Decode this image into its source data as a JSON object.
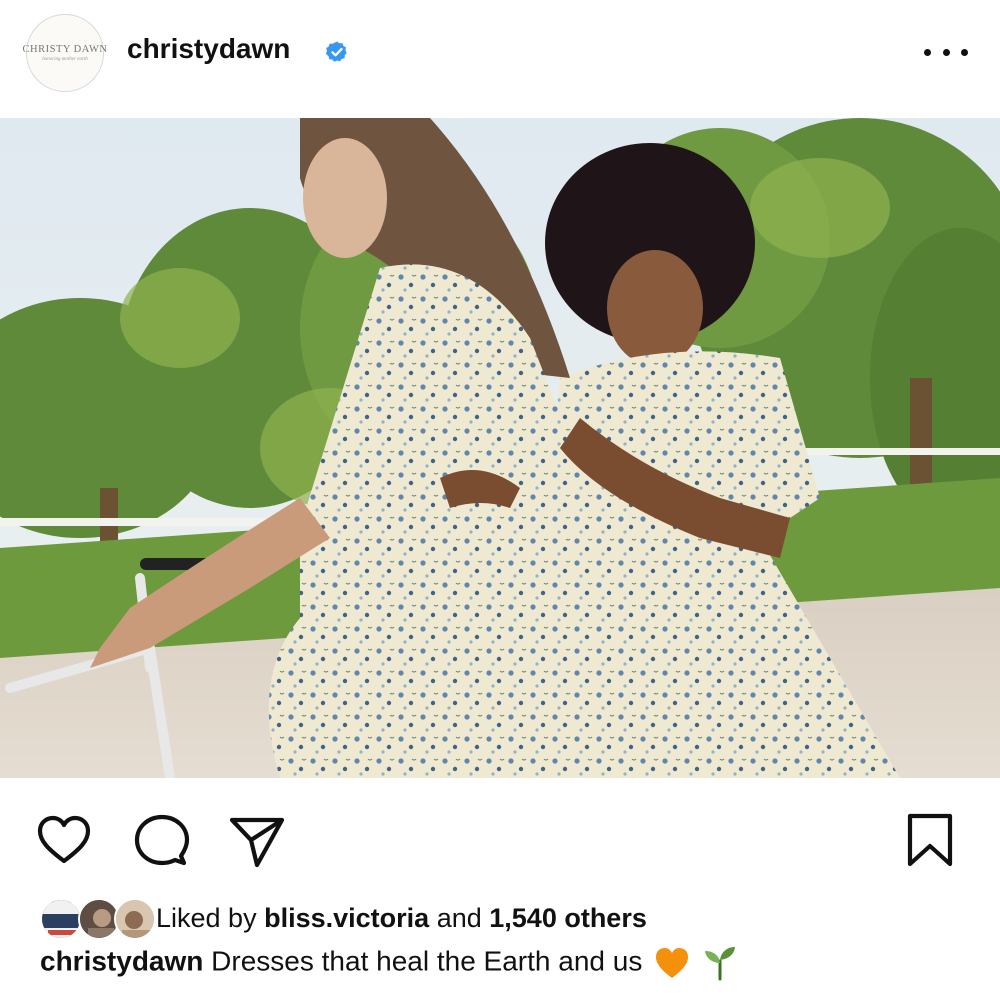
{
  "header": {
    "avatar_brand": "CHRISTY DAWN",
    "avatar_tagline": "honoring mother earth",
    "username": "christydawn",
    "verified": true,
    "more_icon": "more-horizontal-icon"
  },
  "post": {
    "image_subject": "photo"
  },
  "actions": {
    "like_icon": "heart-icon",
    "comment_icon": "comment-icon",
    "share_icon": "send-icon",
    "save_icon": "bookmark-icon"
  },
  "likes": {
    "prefix": "Liked by",
    "user": "bliss.victoria",
    "middle": "and",
    "count": "1,540 others"
  },
  "caption": {
    "username": "christydawn",
    "text": "Dresses that heal the Earth and us",
    "emojis": [
      "orange-heart-icon",
      "seedling-icon"
    ]
  },
  "colors": {
    "verified_blue": "#3897f0",
    "text": "#111111"
  }
}
